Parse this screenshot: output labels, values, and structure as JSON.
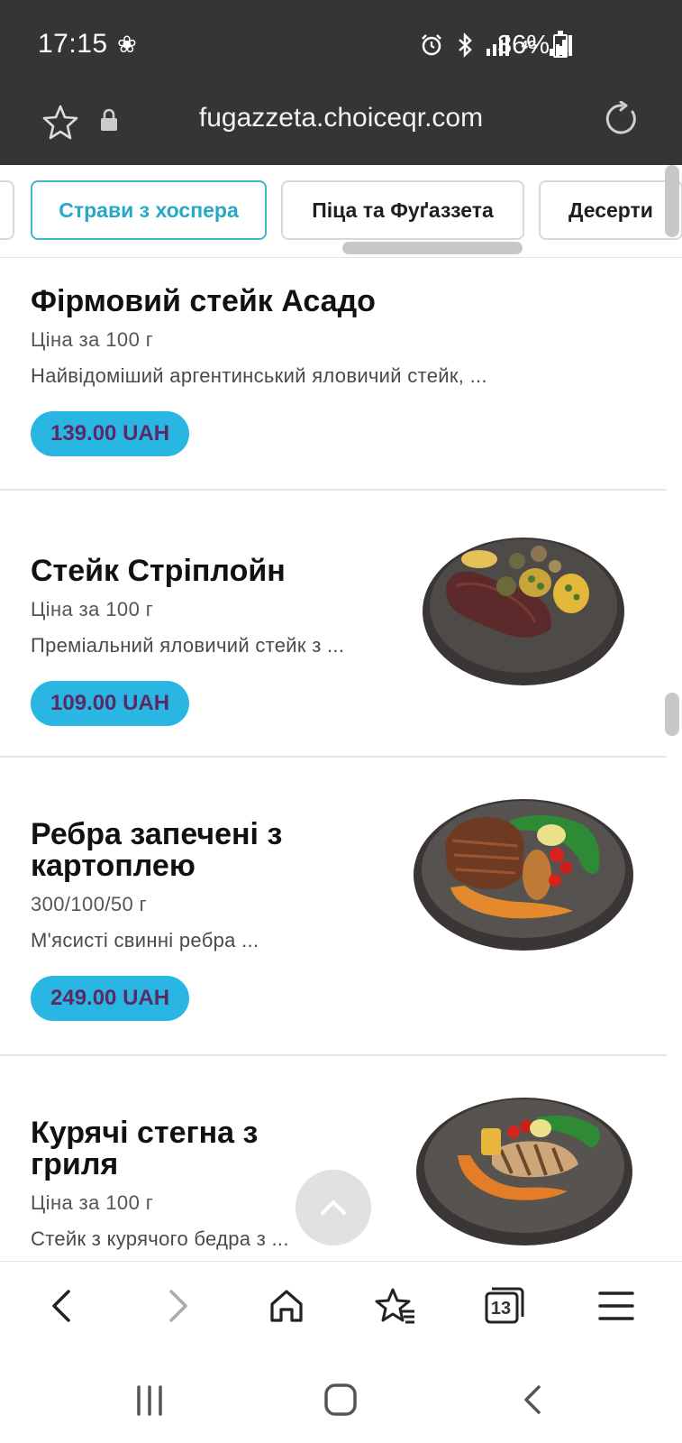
{
  "status_bar": {
    "time": "17:15",
    "network": "4G",
    "battery": "36%"
  },
  "url_bar": {
    "url": "fugazzeta.choiceqr.com"
  },
  "categories": {
    "tabs": [
      {
        "label": "",
        "active": false
      },
      {
        "label": "Страви з хоспера",
        "active": true
      },
      {
        "label": "Піца та Фуґаззета",
        "active": false
      },
      {
        "label": "Десерти",
        "active": false
      }
    ]
  },
  "menu": {
    "items": [
      {
        "name": "Фірмовий стейк Асадо",
        "weight": "Ціна за 100 г",
        "description": "Найвідоміший аргентинський яловичий стейк, ...",
        "price": "139.00 UAH",
        "image": "none"
      },
      {
        "name": "Стейк Стріплойн",
        "weight": "Ціна за 100 г",
        "description": "Преміальний яловичий стейк з ...",
        "price": "109.00 UAH",
        "image": "steak-plate"
      },
      {
        "name": "Ребра запечені з картоплею",
        "weight": "300/100/50 г",
        "description": "М'ясисті свинні ребра ...",
        "price": "249.00 UAH",
        "image": "ribs-plate"
      },
      {
        "name": "Курячі стегна з гриля",
        "weight": "Ціна за 100 г",
        "description": "Стейк з курячого бедра з ...",
        "price": "",
        "image": "chicken-plate"
      }
    ]
  },
  "bottom_toolbar": {
    "tab_count": "13"
  },
  "colors": {
    "accent": "#29b6e3",
    "price_text": "#5a2a67",
    "active_tab": "#3fb6cf",
    "status_bar": "#353535"
  }
}
